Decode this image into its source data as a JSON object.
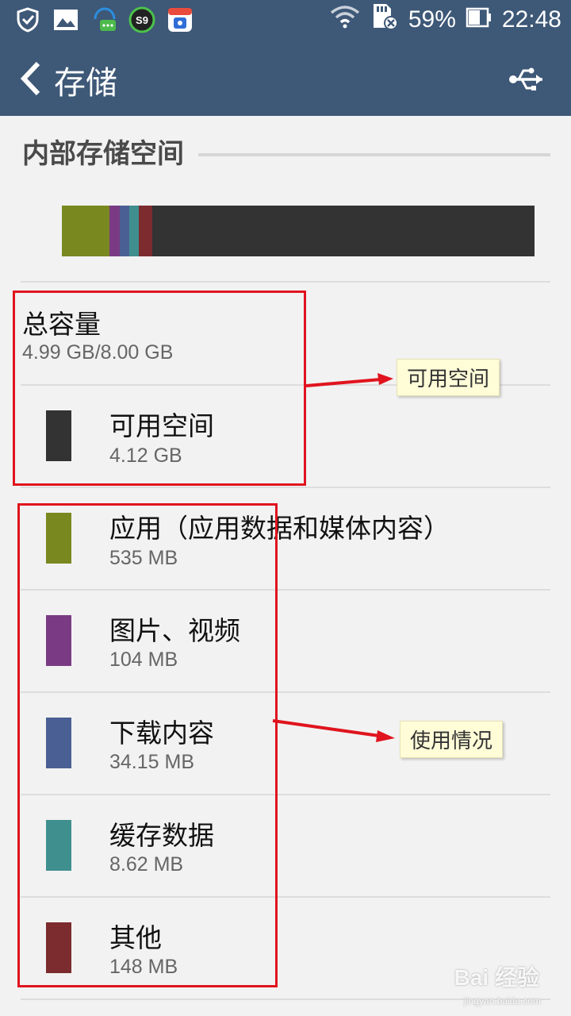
{
  "status_bar": {
    "battery_percent": "59%",
    "time": "22:48",
    "app_icon_badge": "S9",
    "icons": [
      "shield-icon",
      "image-icon",
      "chat-headset-icon",
      "s9-app-icon",
      "baidu-app-icon",
      "wifi-icon",
      "sd-card-error-icon",
      "battery-icon"
    ]
  },
  "action_bar": {
    "title": "存储",
    "icons": [
      "back-arrow-icon",
      "usb-icon"
    ]
  },
  "section": {
    "title": "内部存储空间"
  },
  "usage_bar": {
    "segments": [
      {
        "name": "应用（应用数据和媒体内容）",
        "fraction": 0.1011,
        "color": "#7a8820"
      },
      {
        "name": "图片、视频",
        "fraction": 0.0211,
        "color": "#7a3b84"
      },
      {
        "name": "下载内容",
        "fraction": 0.02,
        "color": "#4a5f94"
      },
      {
        "name": "缓存数据",
        "fraction": 0.02,
        "color": "#3f8f8e"
      },
      {
        "name": "其他",
        "fraction": 0.029,
        "color": "#7c2c2e"
      },
      {
        "name": "可用空间",
        "fraction": 0.8088,
        "color": "#333333"
      }
    ]
  },
  "total": {
    "label": "总容量",
    "value": "4.99 GB/8.00 GB"
  },
  "items": [
    {
      "label": "可用空间",
      "value": "4.12 GB",
      "color": "#333333"
    },
    {
      "label": "应用（应用数据和媒体内容）",
      "value": "535 MB",
      "color": "#7a8820"
    },
    {
      "label": "图片、视频",
      "value": "104 MB",
      "color": "#7a3b84"
    },
    {
      "label": "下载内容",
      "value": "34.15 MB",
      "color": "#4a5f94"
    },
    {
      "label": "缓存数据",
      "value": "8.62 MB",
      "color": "#3f8f8e"
    },
    {
      "label": "其他",
      "value": "148 MB",
      "color": "#7c2c2e"
    }
  ],
  "annotations": {
    "note1": "可用空间",
    "note2": "使用情况",
    "highlight_color": "#e0141e"
  },
  "watermark": {
    "main": "Bai 经验",
    "sub": "jingyan.baidu.com"
  }
}
